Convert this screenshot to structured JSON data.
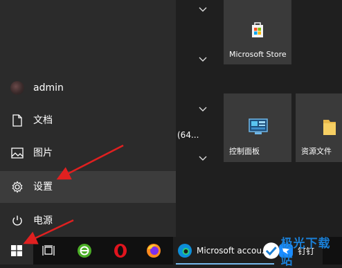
{
  "start_menu": {
    "items": [
      {
        "label": "admin",
        "icon": "user-avatar"
      },
      {
        "label": "文档",
        "icon": "document-icon"
      },
      {
        "label": "图片",
        "icon": "image-icon"
      },
      {
        "label": "设置",
        "icon": "gear-icon"
      },
      {
        "label": "电源",
        "icon": "power-icon"
      }
    ],
    "partial_text": "(64..."
  },
  "tiles": {
    "store": {
      "label": "Microsoft Store",
      "icon": "store-bag-icon"
    },
    "control_panel": {
      "label": "控制面板",
      "icon": "control-panel-icon"
    },
    "file_explorer": {
      "label": "资源文件",
      "icon": "folder-icon"
    }
  },
  "taskbar": {
    "edge_label": "Microsoft accou...",
    "dingtalk_label": "钉钉",
    "icons": [
      "windows-start-icon",
      "task-view-icon",
      "ie-green-icon",
      "opera-icon",
      "firefox-icon",
      "edge-icon",
      "dingtalk-icon"
    ]
  },
  "watermark": {
    "text": "极光下载站"
  },
  "colors": {
    "arrow": "#e02020",
    "accent": "#76b9ed",
    "watermark": "#1a7fd6"
  }
}
